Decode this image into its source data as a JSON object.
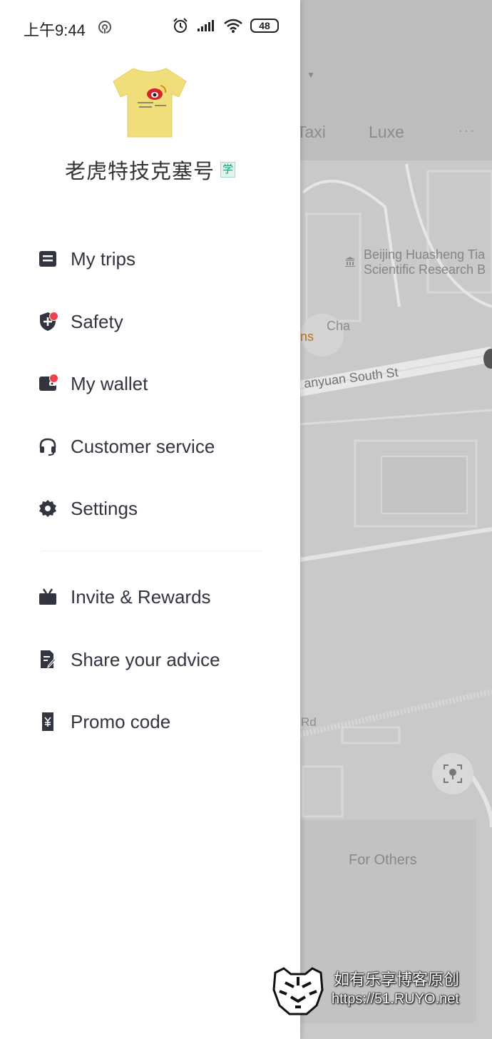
{
  "status_bar": {
    "time": "上午9:44",
    "battery": "48",
    "icons": [
      "sync-icon",
      "alarm-icon",
      "signal-icon",
      "wifi-icon",
      "battery-icon"
    ]
  },
  "profile": {
    "name": "老虎特技克塞号",
    "badge": "学"
  },
  "menu": {
    "primary": [
      {
        "label": "My trips",
        "icon": "trips-icon",
        "dot": false
      },
      {
        "label": "Safety",
        "icon": "shield-plus-icon",
        "dot": true
      },
      {
        "label": "My wallet",
        "icon": "wallet-icon",
        "dot": true
      },
      {
        "label": "Customer service",
        "icon": "headset-icon",
        "dot": false
      },
      {
        "label": "Settings",
        "icon": "gear-icon",
        "dot": false
      }
    ],
    "secondary": [
      {
        "label": "Invite & Rewards",
        "icon": "gift-icon",
        "dot": false
      },
      {
        "label": "Share your advice",
        "icon": "feedback-icon",
        "dot": false
      },
      {
        "label": "Promo code",
        "icon": "coupon-icon",
        "dot": false
      }
    ]
  },
  "map": {
    "tabs": [
      "Taxi",
      "Luxe"
    ],
    "more": "···",
    "poi_line1": "Beijing Huasheng Tia",
    "poi_line2": "Scientific Research B",
    "street": "anyuan South St",
    "road_label": "Rd",
    "cha": "Cha",
    "ns": "ns",
    "for_others": "For Others"
  },
  "watermark": {
    "line1": "如有乐享博客原创",
    "line2": "https://51.RUYO.net"
  },
  "colors": {
    "text": "#323440",
    "red_dot": "#f0404a",
    "badge_green": "#12a56f"
  }
}
